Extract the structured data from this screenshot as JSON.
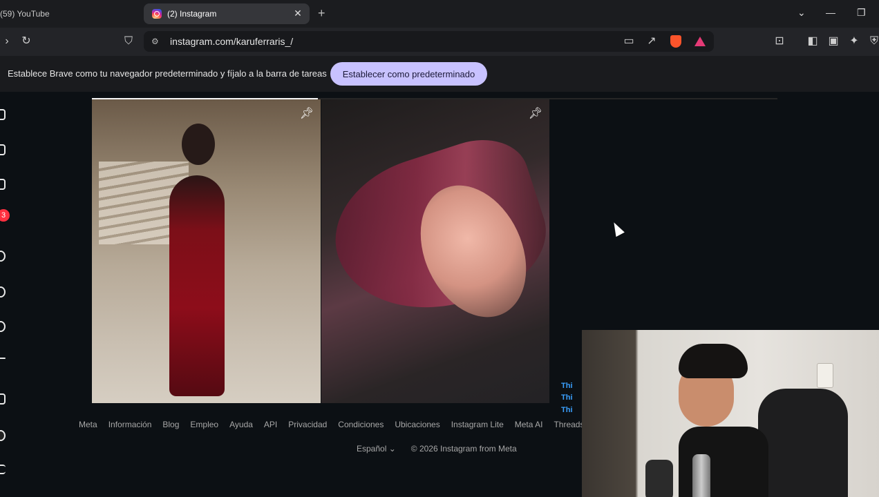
{
  "browser": {
    "tabs": [
      {
        "label": "(59) YouTube",
        "active": false
      },
      {
        "label": "(2) Instagram",
        "active": true
      }
    ],
    "new_tab_label": "+",
    "close_label": "✕",
    "url": "instagram.com/karuferraris_/"
  },
  "default_bar": {
    "message": "Establece Brave como tu navegador predeterminado y fíjalo a la barra de tareas",
    "button_label": "Establecer como predeterminado"
  },
  "sidebar": {
    "notification_count": "3"
  },
  "grid": {
    "progress_fraction": 0.33,
    "posts": [
      {
        "pinned": true,
        "icon": "pin-icon"
      },
      {
        "pinned": true,
        "icon": "pin-icon"
      }
    ]
  },
  "overlay_tags": [
    "Thi",
    "Thi",
    "Thi"
  ],
  "footer": {
    "links": [
      "Meta",
      "Información",
      "Blog",
      "Empleo",
      "Ayuda",
      "API",
      "Privacidad",
      "Condiciones",
      "Ubicaciones",
      "Instagram Lite",
      "Meta AI",
      "Threads"
    ],
    "language": "Español",
    "copyright": "© 2026 Instagram from Meta"
  },
  "colors": {
    "page_bg": "#0c1014",
    "accent_button": "#c8c2ff",
    "badge": "#ff3040"
  }
}
